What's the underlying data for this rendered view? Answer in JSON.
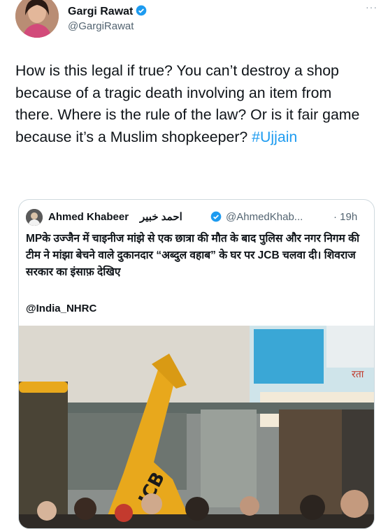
{
  "tweet": {
    "author_name": "Gargi Rawat",
    "author_handle": "@GargiRawat",
    "more_label": "···",
    "text": "How is this legal if true? You can’t destroy a shop because of a tragic death involving an item from there. Where is the rule of the law? Or is it fair game because it’s a Muslim shopkeeper? ",
    "hashtag": "#Ujjain"
  },
  "quote": {
    "author_name": "Ahmed Khabeer",
    "author_name_urdu": "احمد خبیر",
    "author_handle": "@AhmedKhab...",
    "time": "· 19h",
    "text": "MPके उज्जैन में चाइनीज मांझे से एक छात्रा की मौत के बाद पुलिस और नगर निगम की टीम ने मांझा बेचने वाले दुकानदार “अब्दुल वहाब” के घर पर JCB चलवा दी। शिवराज सरकार का इंसाफ़ देखिए",
    "mention": "@India_NHRC",
    "media_texts": {
      "excavator_brand": "JCB",
      "shop_sign": "रता"
    }
  },
  "colors": {
    "accent": "#1d9bf0",
    "excavator": "#e8a81c",
    "secondary_text": "#536471"
  },
  "icons": [
    "verified-badge-icon",
    "more-icon"
  ]
}
